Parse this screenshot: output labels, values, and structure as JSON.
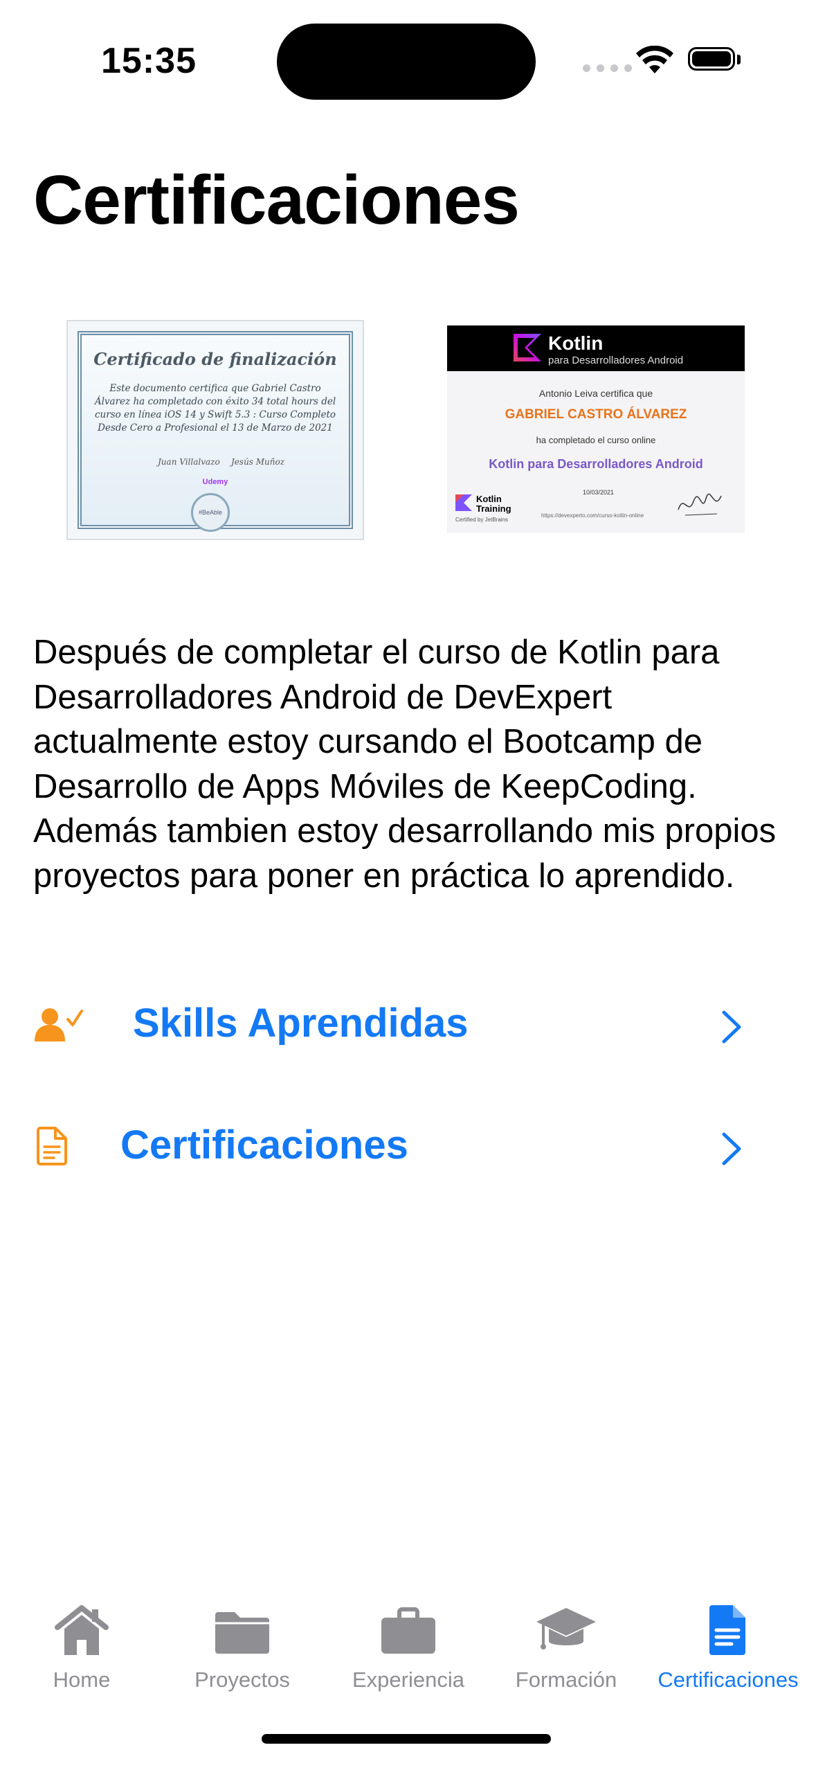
{
  "status_bar": {
    "time": "15:35"
  },
  "page": {
    "title": "Certificaciones"
  },
  "certificates": {
    "udemy": {
      "heading": "Certificado de finalización",
      "body": "Este documento certifica que Gabriel Castro Álvarez ha completado con éxito 34 total hours del curso en línea iOS 14 y Swift 5.3 : Curso Completo Desde Cero a Profesional el 13 de Marzo de 2021",
      "signature_left": "Juan Villalvazo",
      "signature_right": "Jesús Muñoz",
      "logo": "Udemy",
      "seal": "#BeAble"
    },
    "kotlin": {
      "brand": "Kotlin",
      "brand_sub": "para Desarrolladores Android",
      "line1": "Antonio Leiva certifica que",
      "name": "GABRIEL CASTRO ÁLVAREZ",
      "line3": "ha completado el curso online",
      "course": "Kotlin para Desarrolladores Android",
      "date": "10/03/2021",
      "footer_title": "Kotlin Training",
      "footer_sub": "Certified by JetBrains",
      "url": "https://devexperto.com/curso-kotlin-online"
    }
  },
  "description": "Después de completar el curso de Kotlin para Desarrolladores Android de DevExpert actualmente estoy cursando el Bootcamp de Desarrollo de Apps Móviles de KeepCoding. Además tambien estoy desarrollando mis propios proyectos para poner en práctica lo aprendido.",
  "links": [
    {
      "label": "Skills Aprendidas",
      "icon": "person-checkmark-icon"
    },
    {
      "label": "Certificaciones",
      "icon": "document-icon"
    }
  ],
  "tabs": [
    {
      "label": "Home",
      "icon": "house-icon"
    },
    {
      "label": "Proyectos",
      "icon": "folder-icon"
    },
    {
      "label": "Experiencia",
      "icon": "briefcase-icon"
    },
    {
      "label": "Formación",
      "icon": "graduation-cap-icon"
    },
    {
      "label": "Certificaciones",
      "icon": "document-fill-icon",
      "selected": true
    }
  ],
  "colors": {
    "accent": "#1479F4",
    "orange": "#F7941D",
    "tab_inactive": "#8E8E93"
  }
}
